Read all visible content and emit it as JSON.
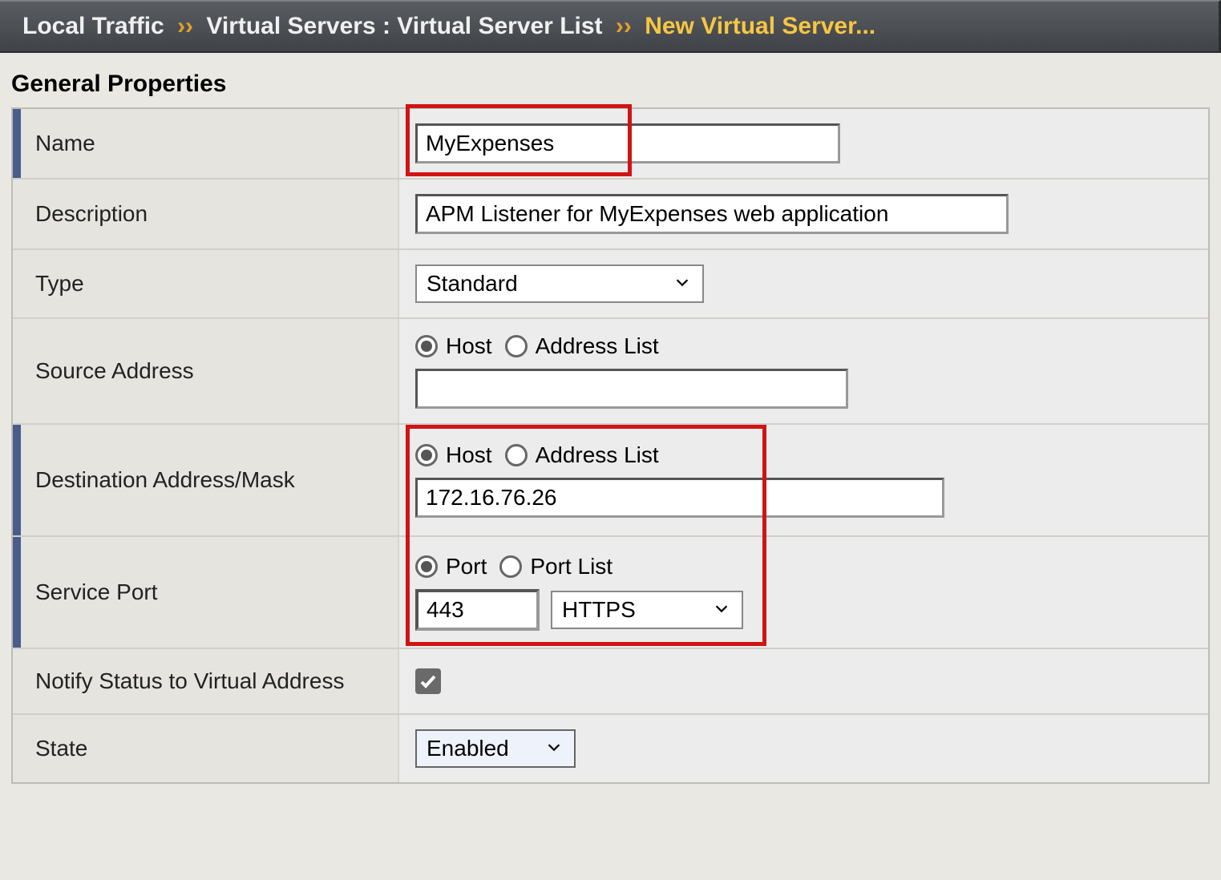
{
  "breadcrumb": {
    "part1": "Local Traffic",
    "sep": "››",
    "part2": "Virtual Servers : Virtual Server List",
    "current": "New Virtual Server..."
  },
  "section_title": "General Properties",
  "rows": {
    "name": {
      "label": "Name",
      "value": "MyExpenses"
    },
    "description": {
      "label": "Description",
      "value": "APM Listener for MyExpenses web application"
    },
    "type": {
      "label": "Type",
      "value": "Standard"
    },
    "source_address": {
      "label": "Source Address",
      "radio_host": "Host",
      "radio_list": "Address List",
      "value": ""
    },
    "destination": {
      "label": "Destination Address/Mask",
      "radio_host": "Host",
      "radio_list": "Address List",
      "value": "172.16.76.26"
    },
    "service_port": {
      "label": "Service Port",
      "radio_port": "Port",
      "radio_list": "Port List",
      "port_value": "443",
      "protocol": "HTTPS"
    },
    "notify": {
      "label": "Notify Status to Virtual Address"
    },
    "state": {
      "label": "State",
      "value": "Enabled"
    }
  }
}
